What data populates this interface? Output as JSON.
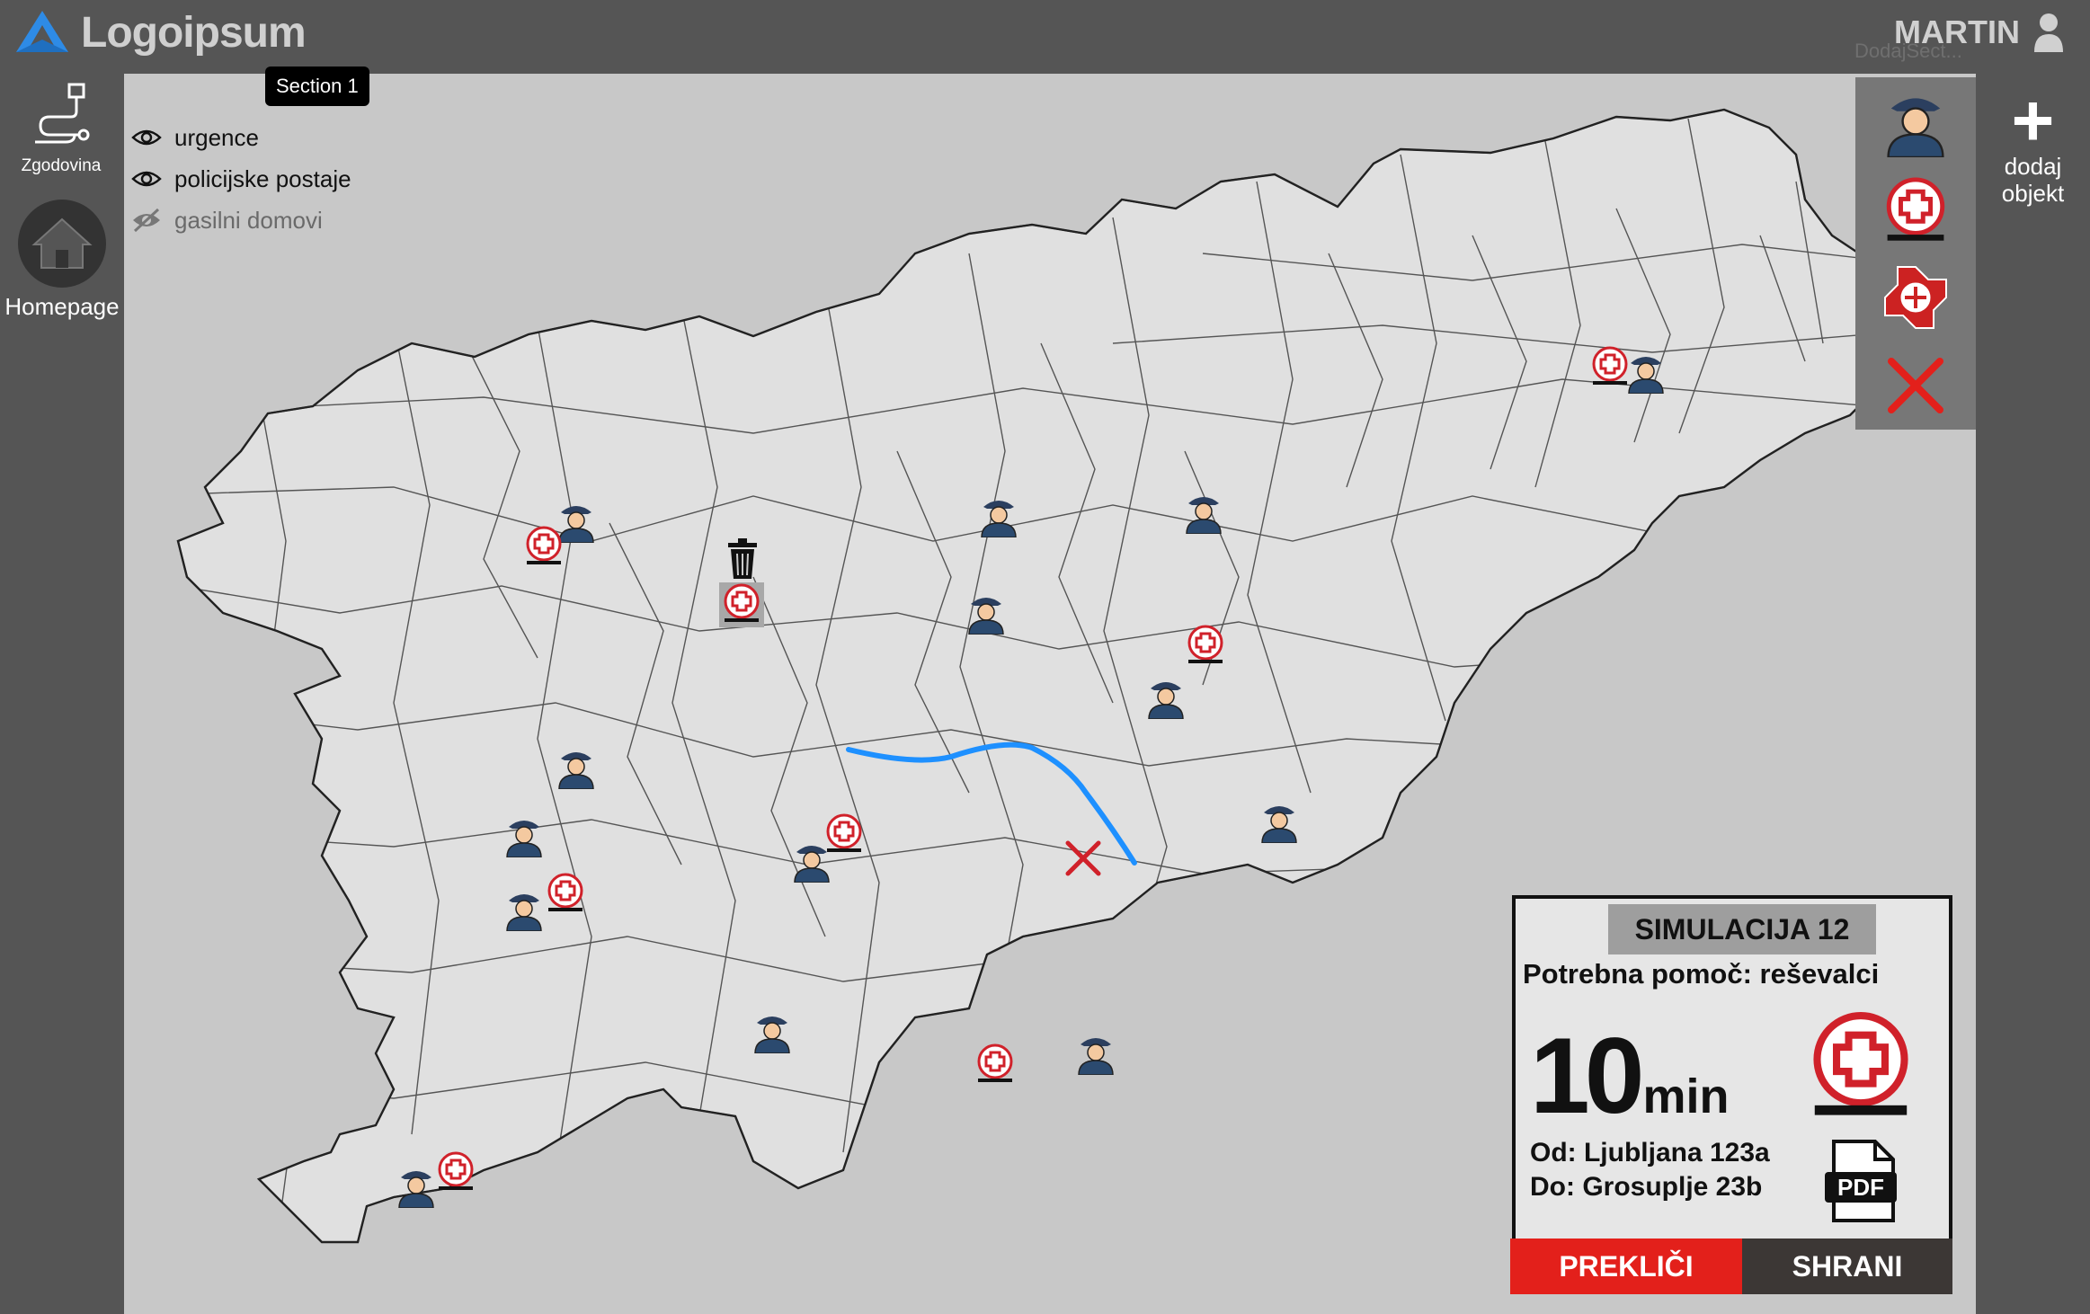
{
  "header": {
    "logo_text": "Logoipsum",
    "user_name": "MARTIN",
    "ghost_label": "DodajSect..."
  },
  "sidebar": {
    "history_label": "Zgodovina",
    "home_label": "Homepage"
  },
  "map": {
    "tooltip": "Section 1",
    "layers": [
      {
        "label": "urgence",
        "visible": true
      },
      {
        "label": "policijske postaje",
        "visible": true
      },
      {
        "label": "gasilni domovi",
        "visible": false
      }
    ]
  },
  "palette": {
    "items": [
      "police-station-icon",
      "ambulance-icon",
      "fire-dept-icon",
      "delete-x-icon"
    ],
    "add_label_line1": "dodaj",
    "add_label_line2": "objekt"
  },
  "simulation": {
    "title": "SIMULACIJA 12",
    "needed_help": "Potrebna pomoč: reševalci",
    "time_value": "10",
    "time_unit": "min",
    "from": "Od: Ljubljana 123a",
    "to": "Do: Grosuplje 23b",
    "pdf_label": "PDF",
    "cancel_label": "PREKLIČI",
    "save_label": "SHRANI"
  },
  "colors": {
    "route": "#1e90ff",
    "cancel": "#e3201b",
    "ambulance": "#d0212a",
    "police": "#2b4a6f"
  }
}
